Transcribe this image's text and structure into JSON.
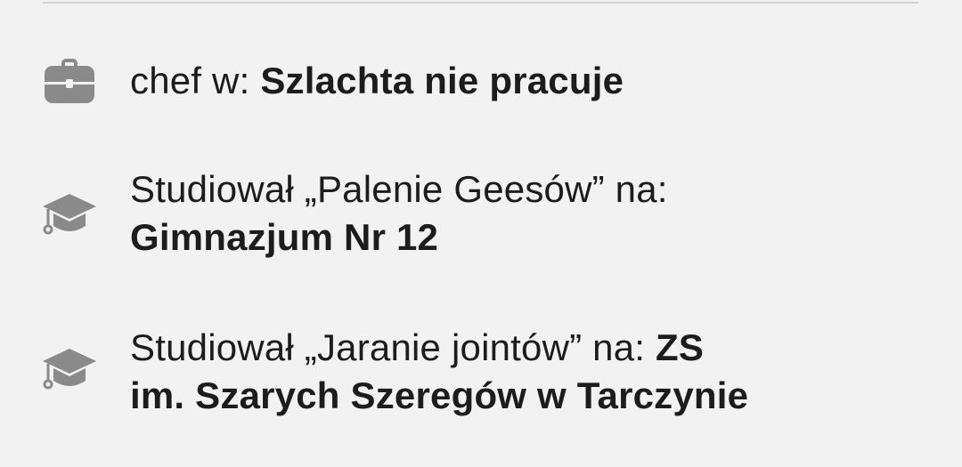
{
  "rows": [
    {
      "icon": "briefcase-icon",
      "prefix": "chef w: ",
      "strong": "Szlachta nie pracuje"
    },
    {
      "icon": "graduation-cap-icon",
      "prefix": "Studiował „Palenie Geesów”  na:",
      "strong": "Gimnazjum Nr 12"
    },
    {
      "icon": "graduation-cap-icon",
      "prefix": "Studiował „Jaranie jointów”  na: ",
      "strong_inline": "ZS",
      "strong": "im. Szarych Szeregów w Tarczynie"
    }
  ],
  "colors": {
    "background": "#f2f2f2",
    "icon": "#8a8a8a",
    "text": "#1c1c1c"
  }
}
